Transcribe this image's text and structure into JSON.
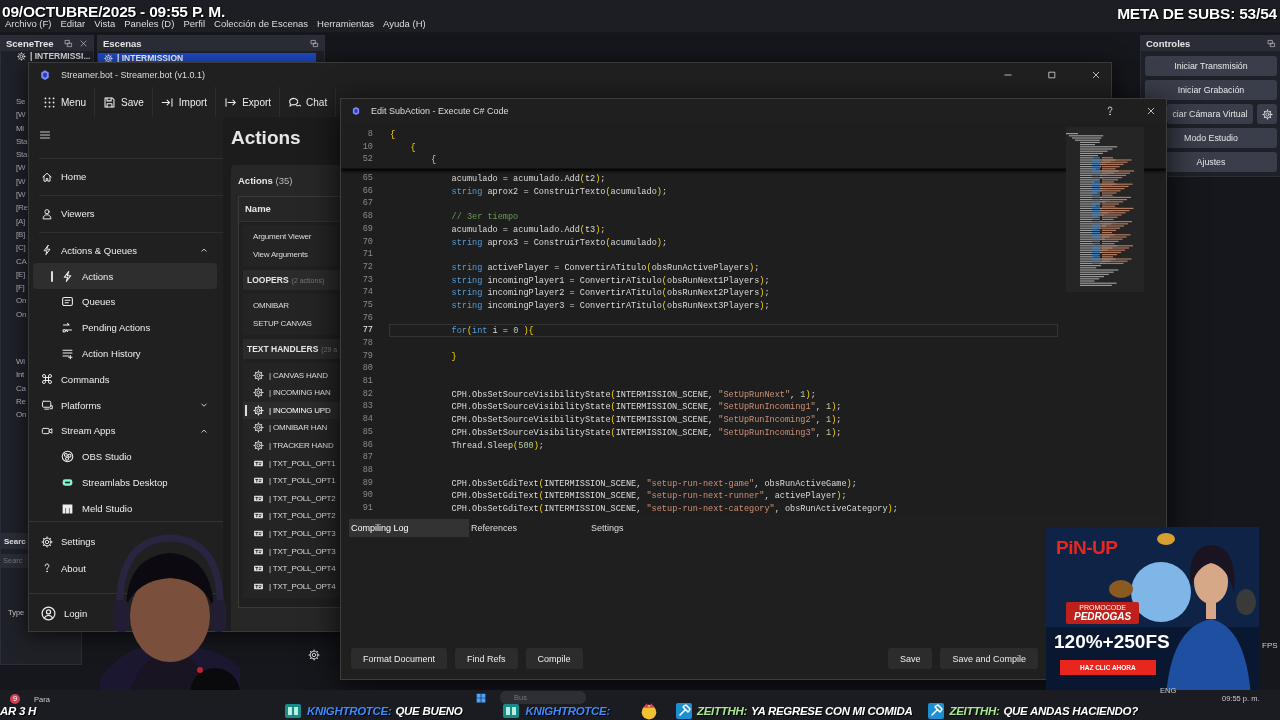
{
  "stream_overlay": {
    "date_time": "09/OCTUBRE/2025 - 09:55 P. M.",
    "sub_goal": "META DE SUBS: 53/54"
  },
  "obs": {
    "menu": [
      "Archivo (F)",
      "Editar",
      "Vista",
      "Paneles (D)",
      "Perfil",
      "Colección de Escenas",
      "Herramientas",
      "Ayuda (H)"
    ],
    "scene_tree": {
      "title": "SceneTree",
      "item": "| INTERMISSI..."
    },
    "scenes": {
      "title": "Escenas",
      "items": [
        {
          "name": "| INTERMISSION",
          "selected": true
        }
      ]
    },
    "source_fragments": [
      "Se",
      "[W",
      "Mi",
      "Sta",
      "Sta",
      "[W",
      "[W",
      "[W",
      "[Re",
      "[A]",
      "[B]",
      "[C]",
      "CA",
      "[E]",
      "[F]",
      "On",
      "On"
    ],
    "source_fragments_2": [
      "Wi",
      "Int",
      "Ca",
      "Re",
      "On"
    ],
    "search_panel": {
      "title": "Searc",
      "placeholder": "Searc",
      "type_label": "Type"
    },
    "controls": {
      "title": "Controles",
      "buttons": [
        {
          "label": "Iniciar Transmisión",
          "settings": false
        },
        {
          "label": "Iniciar Grabación",
          "settings": false
        },
        {
          "label": "ciar Cámara Virtual",
          "settings": true
        },
        {
          "label": "Modo Estudio",
          "settings": false
        },
        {
          "label": "Ajustes",
          "settings": false
        }
      ]
    },
    "status_fps": "FPS"
  },
  "streamerbot": {
    "title": "Streamer.bot - Streamer.bot (v1.0.1)",
    "toolbar": [
      "Menu",
      "Save",
      "Import",
      "Export",
      "Chat"
    ],
    "nav": [
      {
        "label": "Home",
        "selected": false
      },
      {
        "label": "Viewers",
        "selected": false
      },
      {
        "label": "Actions & Queues",
        "selected": false,
        "expanded": true,
        "children": [
          {
            "label": "Actions",
            "selected": true
          },
          {
            "label": "Queues",
            "selected": false
          },
          {
            "label": "Pending Actions",
            "selected": false
          },
          {
            "label": "Action History",
            "selected": false
          }
        ]
      },
      {
        "label": "Commands",
        "selected": false
      },
      {
        "label": "Platforms",
        "selected": false,
        "expanded": false
      },
      {
        "label": "Stream Apps",
        "selected": false,
        "expanded": true,
        "children": [
          {
            "label": "OBS Studio",
            "selected": false
          },
          {
            "label": "Streamlabs Desktop",
            "selected": false
          },
          {
            "label": "Meld Studio",
            "selected": false
          }
        ]
      }
    ],
    "footer": [
      "Settings",
      "About"
    ],
    "login": "Login",
    "page_title": "Actions",
    "actions_panel": {
      "title": "Actions",
      "count": "(35)",
      "column": "Name",
      "groups": [
        {
          "items": [
            {
              "name": "Argument Viewer",
              "selected": false
            },
            {
              "name": "View Arguments",
              "selected": false
            }
          ]
        },
        {
          "title": "LOOPERS",
          "count": "(2 actions)",
          "items": [
            {
              "name": "OMNIBAR",
              "selected": false
            },
            {
              "name": "SETUP CANVAS",
              "selected": false
            }
          ]
        },
        {
          "title": "TEXT HANDLERS",
          "count": "(29 a",
          "items": [
            {
              "kind": "scene",
              "name": "| CANVAS HAND",
              "selected": false
            },
            {
              "kind": "scene",
              "name": "| INCOMING HAN",
              "selected": false
            },
            {
              "kind": "scene",
              "name": "| INCOMING UPD",
              "selected": true
            },
            {
              "kind": "scene",
              "name": "| OMNIBAR HAN",
              "selected": false
            },
            {
              "kind": "scene",
              "name": "| TRACKER HAND",
              "selected": false
            },
            {
              "kind": "text",
              "name": "| TXT_POLL_OPT1",
              "selected": false
            },
            {
              "kind": "text",
              "name": "| TXT_POLL_OPT1",
              "selected": false
            },
            {
              "kind": "text",
              "name": "| TXT_POLL_OPT2",
              "selected": false
            },
            {
              "kind": "text",
              "name": "| TXT_POLL_OPT2",
              "selected": false
            },
            {
              "kind": "text",
              "name": "| TXT_POLL_OPT3",
              "selected": false
            },
            {
              "kind": "text",
              "name": "| TXT_POLL_OPT3",
              "selected": false
            },
            {
              "kind": "text",
              "name": "| TXT_POLL_OPT4",
              "selected": false
            },
            {
              "kind": "text",
              "name": "| TXT_POLL_OPT4",
              "selected": false
            }
          ]
        }
      ]
    }
  },
  "code_dialog": {
    "title": "Edit SubAction - Execute C# Code",
    "sticky_lines": [
      {
        "n": "8",
        "code": "{"
      },
      {
        "n": "10",
        "code": "    {"
      },
      {
        "n": "52",
        "code": "        {"
      }
    ],
    "lines": [
      {
        "n": "65",
        "current": false,
        "code": "            acumulado = acumulado.Add(t2);"
      },
      {
        "n": "66",
        "current": false,
        "code": "            string aprox2 = ConstruirTexto(acumulado);"
      },
      {
        "n": "67",
        "current": false
      },
      {
        "n": "68",
        "current": false,
        "code": "            // 3er tiempo"
      },
      {
        "n": "69",
        "current": false,
        "code": "            acumulado = acumulado.Add(t3);"
      },
      {
        "n": "70",
        "current": false,
        "code": "            string aprox3 = ConstruirTexto(acumulado);"
      },
      {
        "n": "71",
        "current": false
      },
      {
        "n": "72",
        "current": false,
        "code": "            string activePlayer = ConvertirATitulo(obsRunActivePlayers);"
      },
      {
        "n": "73",
        "current": false,
        "code": "            string incomingPlayer1 = ConvertirATitulo(obsRunNext1Players);"
      },
      {
        "n": "74",
        "current": false,
        "code": "            string incomingPlayer2 = ConvertirATitulo(obsRunNext2Players);"
      },
      {
        "n": "75",
        "current": false,
        "code": "            string incomingPlayer3 = ConvertirATitulo(obsRunNext3Players);"
      },
      {
        "n": "76",
        "current": false
      },
      {
        "n": "77",
        "current": true,
        "code": "            for(int i = 0 ){"
      },
      {
        "n": "78",
        "current": false
      },
      {
        "n": "79",
        "current": false,
        "code": "            }"
      },
      {
        "n": "80",
        "current": false
      },
      {
        "n": "81",
        "current": false
      },
      {
        "n": "82",
        "current": false,
        "code": "            CPH.ObsSetSourceVisibilityState(INTERMISSION_SCENE, \"SetUpRunNext\", 1);"
      },
      {
        "n": "83",
        "current": false,
        "code": "            CPH.ObsSetSourceVisibilityState(INTERMISSION_SCENE, \"SetUpRunIncoming1\", 1);"
      },
      {
        "n": "84",
        "current": false,
        "code": "            CPH.ObsSetSourceVisibilityState(INTERMISSION_SCENE, \"SetUpRunIncoming2\", 1);"
      },
      {
        "n": "85",
        "current": false,
        "code": "            CPH.ObsSetSourceVisibilityState(INTERMISSION_SCENE, \"SetUpRunIncoming3\", 1);"
      },
      {
        "n": "86",
        "current": false,
        "code": "            Thread.Sleep(500);"
      },
      {
        "n": "87",
        "current": false
      },
      {
        "n": "88",
        "current": false
      },
      {
        "n": "89",
        "current": false,
        "code": "            CPH.ObsSetGdiText(INTERMISSION_SCENE, \"setup-run-next-game\", obsRunActiveGame);"
      },
      {
        "n": "90",
        "current": false,
        "code": "            CPH.ObsSetGdiText(INTERMISSION_SCENE, \"setup-run-next-runner\", activePlayer);"
      },
      {
        "n": "91",
        "current": false,
        "code": "            CPH.ObsSetGdiText(INTERMISSION_SCENE, \"setup-run-next-category\", obsRunActiveCategory);"
      }
    ],
    "tabs": [
      {
        "label": "Compiling Log",
        "selected": true
      },
      {
        "label": "References",
        "selected": false
      },
      {
        "label": "Settings",
        "selected": false
      }
    ],
    "left_buttons": [
      "Format Document",
      "Find Refs",
      "Compile"
    ],
    "right_buttons": [
      "Save",
      "Save and Compile"
    ]
  },
  "ad": {
    "kind": "picture",
    "logo": "PiN-UP",
    "promo_label": "PROMOCODE",
    "promo_code": "PEDROGAS",
    "offer": "120%+250FS",
    "cta": "HAZ CLIC AHORA"
  },
  "taskbar": {
    "badge": "9",
    "weather": "Para",
    "search_placeholder": "Bus",
    "language": "ENG",
    "clock": "09:55 p. m."
  },
  "ticker": {
    "lead": "AR 3 H",
    "messages": [
      {
        "kind": "logo",
        "user": "KNIGHTROTCE:",
        "color": "#3d8bff",
        "message": "QUE BUENO",
        "emote": false
      },
      {
        "kind": "logo",
        "user": "KNIGHTROTCE:",
        "color": "#3d8bff",
        "emote": true
      },
      {
        "kind": "hammer",
        "user": "ZEITTHH:",
        "color": "#a8e890",
        "message": "YA REGRESE CON MI COMIDA",
        "emote": false
      },
      {
        "kind": "hammer",
        "user": "ZEITTHH:",
        "color": "#a8e890",
        "message": "QUE ANDAS HACIENDO?",
        "emote": false
      }
    ]
  }
}
